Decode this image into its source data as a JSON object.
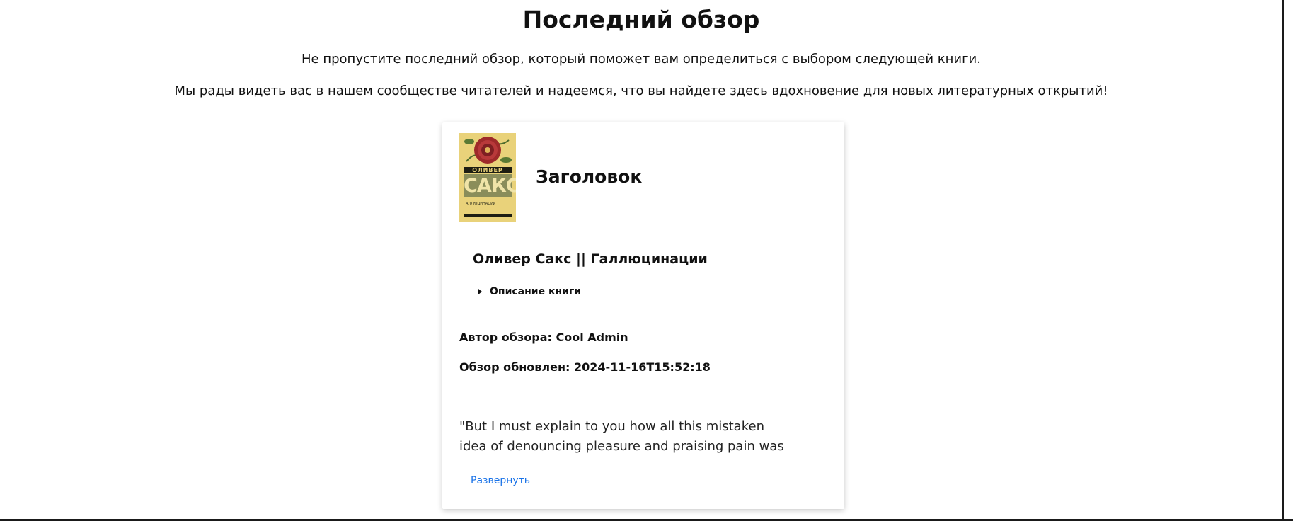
{
  "header": {
    "title": "Последний обзор",
    "intro_line_1": "Не пропустите последний обзор, который поможет вам определиться с выбором следующей книги.",
    "intro_line_2": "Мы рады видеть вас в нашем сообществе читателей и надеемся, что вы найдете здесь вдохновение для новых литературных открытий!"
  },
  "review_card": {
    "heading": "Заголовок",
    "book_title": "Оливер Сакс || Галлюцинации",
    "description_toggle_label": "Описание книги",
    "author_line": "Автор обзора: Cool Admin",
    "updated_line": "Обзор обновлен: 2024-11-16T15:52:18",
    "excerpt": "\"But I must explain to you how all this mistaken idea of denouncing pleasure and praising pain was",
    "expand_label": "Развернуть",
    "cover": {
      "author_band": "ОЛИВЕР",
      "author_name": "САКС",
      "subtitle": "ГАЛЛЮЦИНАЦИИ"
    }
  },
  "colors": {
    "link": "#1a73e8",
    "cover_background": "#e9d27a",
    "cover_panel": "#8a8d5a"
  }
}
